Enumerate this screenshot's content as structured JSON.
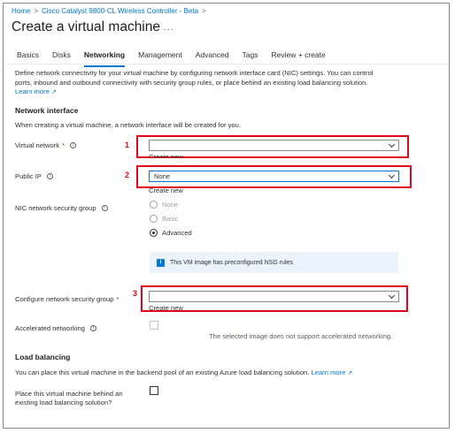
{
  "breadcrumb": {
    "home": "Home",
    "sep1": ">",
    "product": "Cisco Catalyst 9800-CL Wireless Controller - Beta",
    "sep2": ">"
  },
  "page": {
    "title": "Create a virtual machine",
    "more": "···"
  },
  "tabs": [
    {
      "label": "Basics"
    },
    {
      "label": "Disks"
    },
    {
      "label": "Networking"
    },
    {
      "label": "Management"
    },
    {
      "label": "Advanced"
    },
    {
      "label": "Tags"
    },
    {
      "label": "Review + create"
    }
  ],
  "description": {
    "line1": "Define network connectivity for your virtual machine by configuring network interface card (NIC) settings. You can control",
    "line2": "ports, inbound and outbound connectivity with security group rules, or place behind an existing load balancing solution.",
    "learn_more": "Learn more"
  },
  "network_interface": {
    "title": "Network interface",
    "subtitle": "When creating a virtual machine, a network interface will be created for you.",
    "virtual_network": {
      "label": "Virtual network",
      "required": "*",
      "value": "",
      "create_new": "Create new",
      "marker": "1"
    },
    "public_ip": {
      "label": "Public IP",
      "value": "None",
      "create_new": "Create new",
      "marker": "2"
    },
    "nsg": {
      "label": "NIC network security group",
      "options": [
        "None",
        "Basic",
        "Advanced"
      ],
      "selected": "Advanced",
      "info": "This VM image has preconfigured NSG rules"
    },
    "configure_nsg": {
      "label": "Configure network security group",
      "required": "*",
      "value": "",
      "create_new": "Create new",
      "marker": "3"
    },
    "accelerated": {
      "label": "Accelerated networking",
      "note": "The selected image does not support accelerated networking."
    }
  },
  "load_balancing": {
    "title": "Load balancing",
    "description": "You can place this virtual machine in the backend pool of an existing Azure load balancing solution.",
    "learn_more": "Learn more",
    "place_label_1": "Place this virtual machine behind an",
    "place_label_2": "existing load balancing solution?"
  },
  "colors": {
    "accent": "#0078d4",
    "annotation": "#e3061b",
    "required": "#a4262c"
  }
}
